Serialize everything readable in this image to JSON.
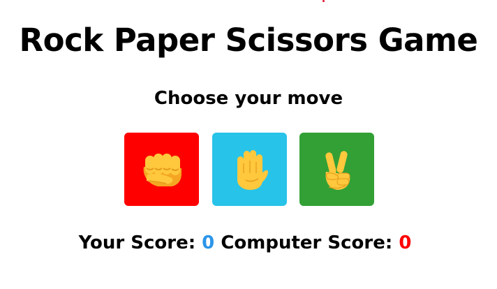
{
  "title": "Rock Paper Scissors Game",
  "subtitle": "Choose your move",
  "moves": [
    {
      "id": "rock",
      "icon": "fist-icon",
      "color": "#ff0000"
    },
    {
      "id": "paper",
      "icon": "raised-hand-icon",
      "color": "#28c3e8"
    },
    {
      "id": "scissors",
      "icon": "victory-hand-icon",
      "color": "#33a035"
    }
  ],
  "score": {
    "player_label": "Your Score:",
    "player_value": "0",
    "player_color": "#2b95e9",
    "computer_label": "Computer Score:",
    "computer_value": "0",
    "computer_color": "#ff0000"
  }
}
